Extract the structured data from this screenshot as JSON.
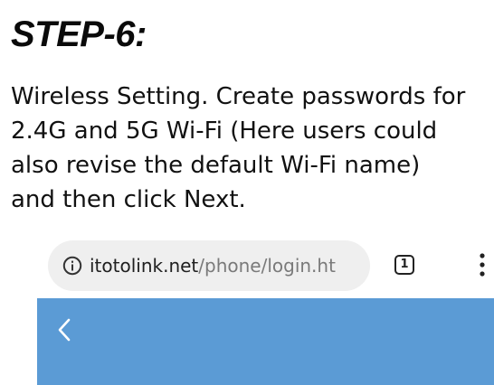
{
  "step": {
    "title": "STEP-6:"
  },
  "instructions": {
    "lines": [
      "Wireless Setting. Create passwords for",
      "2.4G and 5G Wi-Fi (Here users could",
      "also revise the default Wi-Fi name)",
      "and then click Next."
    ]
  },
  "browser": {
    "url_host": "itotolink.net",
    "url_path": "/phone/login.ht",
    "tab_count": "1",
    "icons": {
      "info": "info-icon",
      "tabs": "tab-switcher-icon",
      "menu": "more-vert-icon",
      "back": "back-arrow-icon"
    }
  },
  "app": {
    "header_color": "#5b9bd5"
  }
}
